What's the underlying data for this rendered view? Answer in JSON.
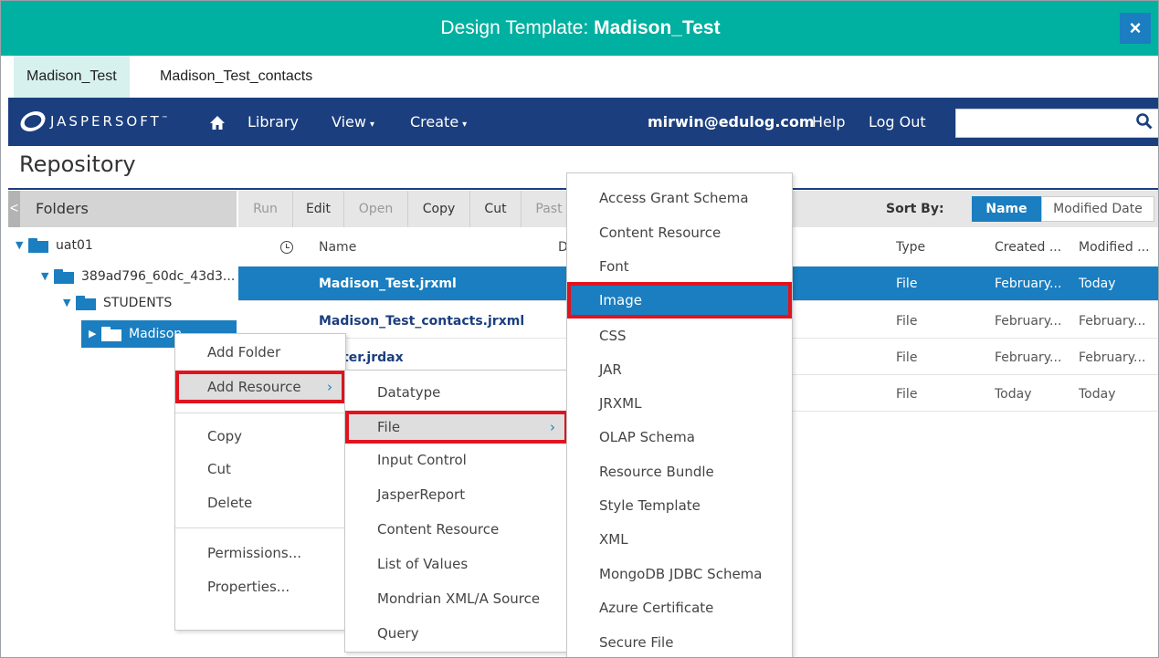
{
  "window": {
    "title_prefix": "Design Template: ",
    "title_bold": "Madison_Test",
    "close_label": "×"
  },
  "tabs": [
    {
      "label": "Madison_Test"
    },
    {
      "label": "Madison_Test_contacts"
    }
  ],
  "nav": {
    "logo_text": "JASPERSOFT",
    "logo_tm": "™",
    "home_icon": "home-icon",
    "library": "Library",
    "view": "View",
    "create": "Create",
    "caret": "▾",
    "user": "mirwin@edulog.com",
    "help": "Help",
    "logout": "Log Out",
    "search_value": "",
    "search_icon": "⚲"
  },
  "repository": {
    "title": "Repository"
  },
  "folders": {
    "header": "Folders",
    "collapse_glyph": "<",
    "tree": [
      {
        "label": "uat01"
      },
      {
        "label": "389ad796_60dc_43d3..."
      },
      {
        "label": "STUDENTS"
      },
      {
        "label": "Madison"
      }
    ]
  },
  "toolbar": {
    "run": "Run",
    "edit": "Edit",
    "open": "Open",
    "copy": "Copy",
    "cut": "Cut",
    "paste": "Past",
    "sort_by": "Sort By:",
    "sort_name": "Name",
    "sort_modified": "Modified Date"
  },
  "list": {
    "headers": {
      "name": "Name",
      "desc": "D",
      "type": "Type",
      "created": "Created ...",
      "modified": "Modified ..."
    },
    "rows": [
      {
        "name": "Madison_Test.jrxml",
        "type": "File",
        "created": "February...",
        "modified": "Today"
      },
      {
        "name": "Madison_Test_contacts.jrxml",
        "type": "File",
        "created": "February...",
        "modified": "February..."
      },
      {
        "name": "pter.jrdax",
        "type": "File",
        "created": "February...",
        "modified": "February..."
      },
      {
        "name": "",
        "type": "File",
        "created": "Today",
        "modified": "Today"
      }
    ]
  },
  "context_menu": {
    "add_folder": "Add Folder",
    "add_resource": "Add Resource",
    "copy": "Copy",
    "cut": "Cut",
    "delete": "Delete",
    "permissions": "Permissions...",
    "properties": "Properties...",
    "arrow": "›"
  },
  "resource_menu": {
    "items": [
      "Datatype",
      "File",
      "Input Control",
      "JasperReport",
      "Content Resource",
      "List of Values",
      "Mondrian XML/A Source",
      "Query"
    ]
  },
  "file_menu": {
    "items": [
      "Access Grant Schema",
      "Content Resource",
      "Font",
      "Image",
      "CSS",
      "JAR",
      "JRXML",
      "OLAP Schema",
      "Resource Bundle",
      "Style Template",
      "XML",
      "MongoDB JDBC Schema",
      "Azure Certificate",
      "Secure File"
    ]
  },
  "colors": {
    "teal": "#00b0a0",
    "navy": "#1b3e7e",
    "blue": "#1a7ec0",
    "highlight_red": "#e0141e"
  }
}
